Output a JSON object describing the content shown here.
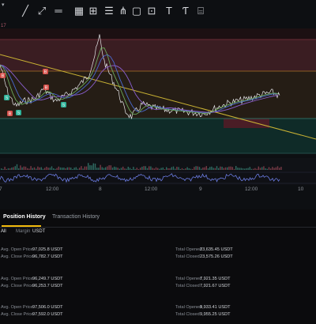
{
  "toolbar": {
    "caret": "▾",
    "number": "17",
    "icons": [
      "line-tool-icon",
      "ray-tool-icon",
      "measure-tool-icon",
      "grid-tool-icon",
      "range-tool-icon",
      "fib-tool-icon",
      "pitchfork-tool-icon",
      "rectangle-tool-icon",
      "date-range-icon",
      "text-tool-icon",
      "note-tool-icon",
      "frame-tool-icon"
    ]
  },
  "chart": {
    "x_labels": [
      "7",
      "12:00",
      "8",
      "12:00",
      "9",
      "12:00",
      "10"
    ],
    "markers": [
      {
        "label": "B",
        "color": "#d5504a"
      },
      {
        "label": "S",
        "color": "#2fb39a"
      },
      {
        "label": "B",
        "color": "#d5504a"
      },
      {
        "label": "S",
        "color": "#2fb39a"
      },
      {
        "label": "B",
        "color": "#d5504a"
      },
      {
        "label": "B",
        "color": "#d5504a"
      },
      {
        "label": "S",
        "color": "#2fb39a"
      }
    ],
    "colors": {
      "red_band": "#3a1d22",
      "orange_band": "#3a2a18",
      "green_band": "#0f2b28",
      "price_line": "#e6e7ea",
      "trend_line": "#c9b233",
      "ma_blue": "#4a6ad0",
      "ma_purple": "#8a5fd0",
      "ma_green": "#6aa85a",
      "indicator": "#6a7be0"
    }
  },
  "tabs": {
    "position_history": "Position History",
    "transaction_history": "Transaction History"
  },
  "filters": {
    "all": "All",
    "margin": "Margin",
    "usdt": "USDT"
  },
  "rows": [
    {
      "open_label": "Avg. Open Price",
      "open_price": "97,025.8 USDT",
      "close_label": "Avg. Close Price",
      "close_price": "96,782.7 USDT",
      "total_opened_label": "Total Opened",
      "total_opened": "23,635.45 USDT",
      "total_closed_label": "Total Closed",
      "total_closed": "23,575.26 USDT"
    },
    {
      "open_label": "Avg. Open Price",
      "open_price": "96,249.7 USDT",
      "close_label": "Avg. Close Price",
      "close_price": "96,253.7 USDT",
      "total_opened_label": "Total Opened",
      "total_opened": "7,921.35 USDT",
      "total_closed_label": "Total Closed",
      "total_closed": "7,921.67 USDT"
    },
    {
      "open_label": "Avg. Open Price",
      "open_price": "97,506.0 USDT",
      "close_label": "Avg. Close Price",
      "close_price": "97,592.0 USDT",
      "total_opened_label": "Total Opened",
      "total_opened": "9,933.41 USDT",
      "total_closed_label": "Total Closed",
      "total_closed": "9,955.25 USDT"
    }
  ]
}
